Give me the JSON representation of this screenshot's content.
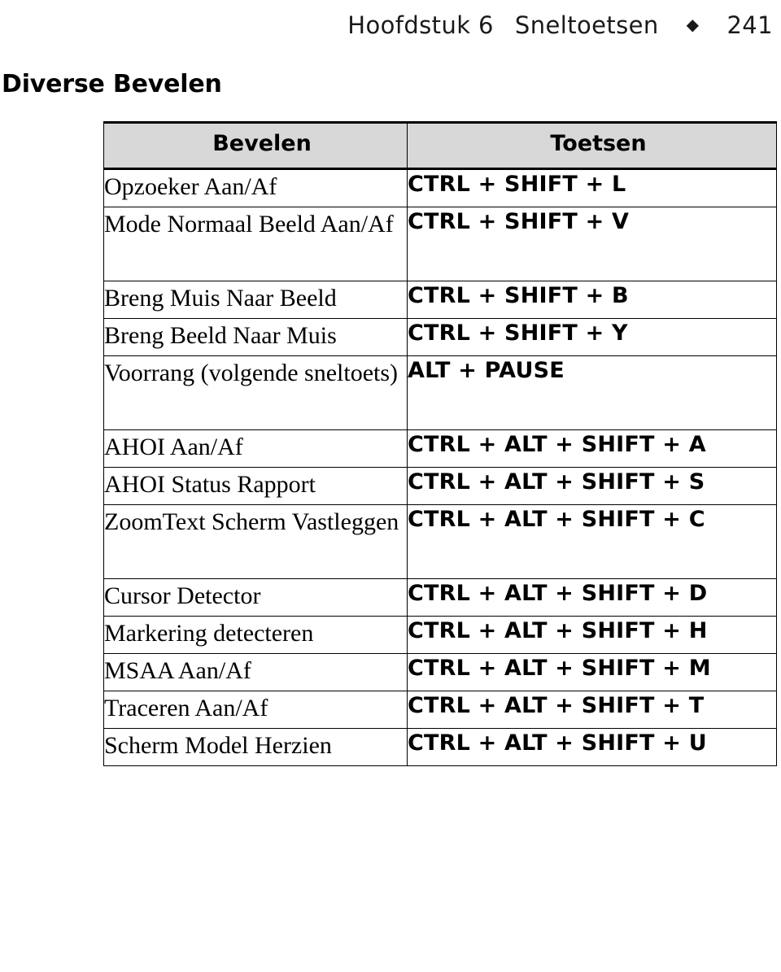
{
  "running_header": {
    "chapter": "Hoofdstuk 6",
    "title": "Sneltoetsen",
    "separator_icon": "◆",
    "page_number": "241"
  },
  "section": {
    "heading": "Diverse Bevelen"
  },
  "table": {
    "columns": [
      "Bevelen",
      "Toetsen"
    ],
    "rows": [
      {
        "command": "Opzoeker Aan/Af",
        "keys": "CTRL + SHIFT + L",
        "lines": 1
      },
      {
        "command": "Mode Normaal Beeld Aan/Af",
        "keys": "CTRL + SHIFT + V",
        "lines": 2
      },
      {
        "command": "Breng Muis Naar Beeld",
        "keys": "CTRL + SHIFT + B",
        "lines": 1
      },
      {
        "command": "Breng Beeld Naar Muis",
        "keys": "CTRL + SHIFT + Y",
        "lines": 1
      },
      {
        "command": "Voorrang (volgende sneltoets)",
        "keys": "ALT + PAUSE",
        "lines": 2
      },
      {
        "command": "AHOI Aan/Af",
        "keys": "CTRL + ALT + SHIFT + A",
        "lines": 1
      },
      {
        "command": "AHOI Status Rapport",
        "keys": "CTRL + ALT + SHIFT + S",
        "lines": 1
      },
      {
        "command": "ZoomText Scherm Vastleggen",
        "keys": "CTRL + ALT + SHIFT + C",
        "lines": 2
      },
      {
        "command": "Cursor Detector",
        "keys": "CTRL + ALT + SHIFT + D",
        "lines": 1
      },
      {
        "command": "Markering detecteren",
        "keys": "CTRL + ALT + SHIFT + H",
        "lines": 1
      },
      {
        "command": "MSAA Aan/Af",
        "keys": "CTRL + ALT + SHIFT + M",
        "lines": 1
      },
      {
        "command": "Traceren Aan/Af",
        "keys": "CTRL + ALT + SHIFT + T",
        "lines": 1
      },
      {
        "command": "Scherm Model Herzien",
        "keys": "CTRL + ALT + SHIFT + U",
        "lines": 1
      }
    ]
  },
  "colors": {
    "header_row_background": "#d8d8d8",
    "text": "#000000",
    "page_background": "#ffffff",
    "border": "#000000"
  }
}
